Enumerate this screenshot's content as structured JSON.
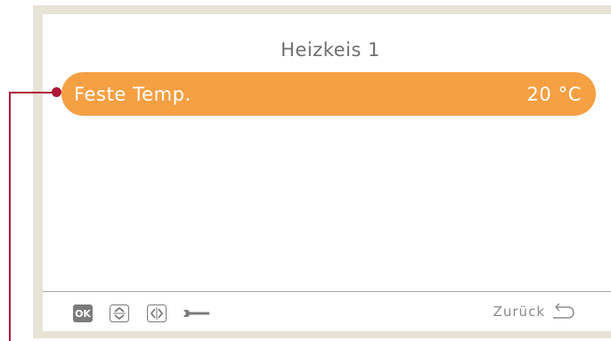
{
  "header": {
    "title": "Heizkeis 1"
  },
  "menu": {
    "selected_item": {
      "label": "Feste Temp.",
      "value": "20 °C"
    }
  },
  "footer": {
    "ok_label": "OK",
    "back_label": "Zurück",
    "icons": [
      "ok-icon",
      "up-down-icon",
      "left-right-icon",
      "wrench-icon",
      "return-arrow-icon"
    ]
  },
  "colors": {
    "accent": "#f5a043",
    "frame": "#e9e2d6",
    "callout": "#b0183a",
    "text": "#6e6e6e"
  }
}
